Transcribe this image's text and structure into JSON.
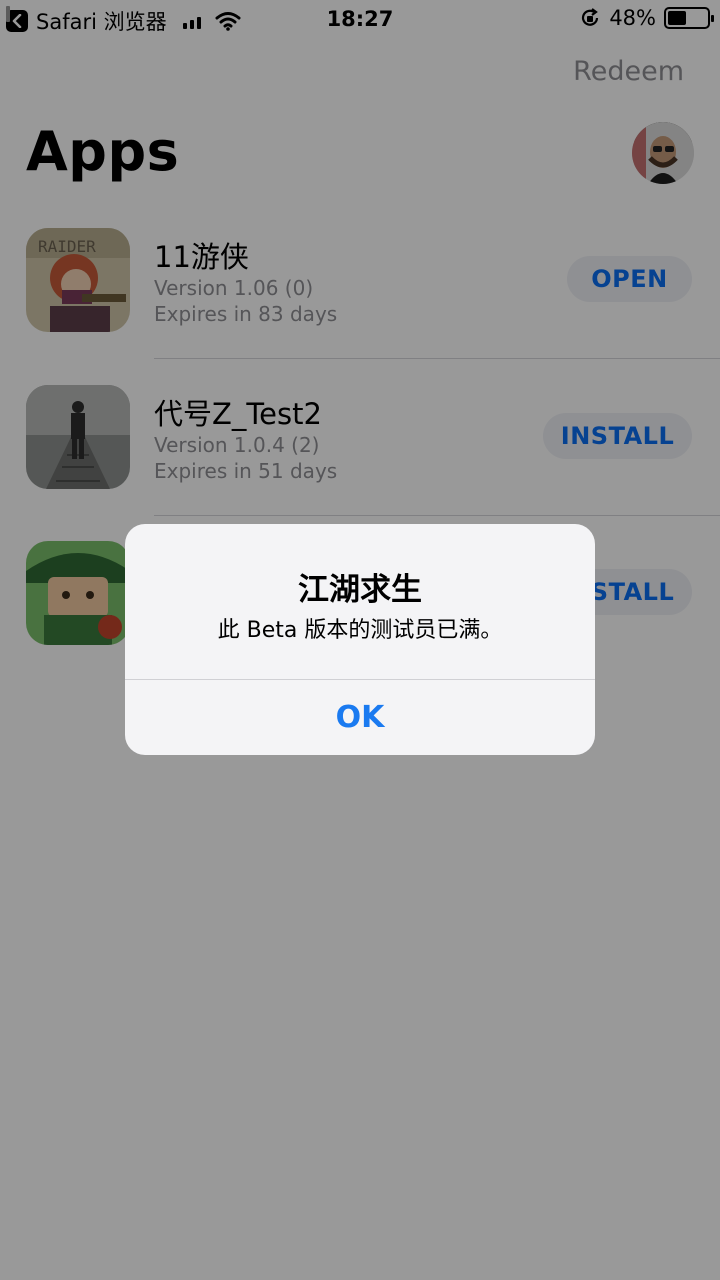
{
  "status_bar": {
    "back_app": "Safari 浏览器",
    "time": "18:27",
    "battery_percent": "48%",
    "battery_level": 0.48
  },
  "header": {
    "redeem_label": "Redeem",
    "title": "Apps"
  },
  "apps": [
    {
      "name": "11游侠",
      "version": "Version 1.06 (0)",
      "expiry": "Expires in 83 days",
      "action": "OPEN"
    },
    {
      "name": "代号Z_Test2",
      "version": "Version 1.0.4 (2)",
      "expiry": "Expires in 51 days",
      "action": "INSTALL"
    },
    {
      "name": "",
      "version": "",
      "expiry": "",
      "action": "INSTALL"
    }
  ],
  "alert": {
    "title": "江湖求生",
    "message": "此 Beta 版本的测试员已满。",
    "button": "OK"
  },
  "colors": {
    "accent": "#0a6ff2",
    "secondary_text": "#8e8e93",
    "pill_bg": "#eef0f5"
  }
}
